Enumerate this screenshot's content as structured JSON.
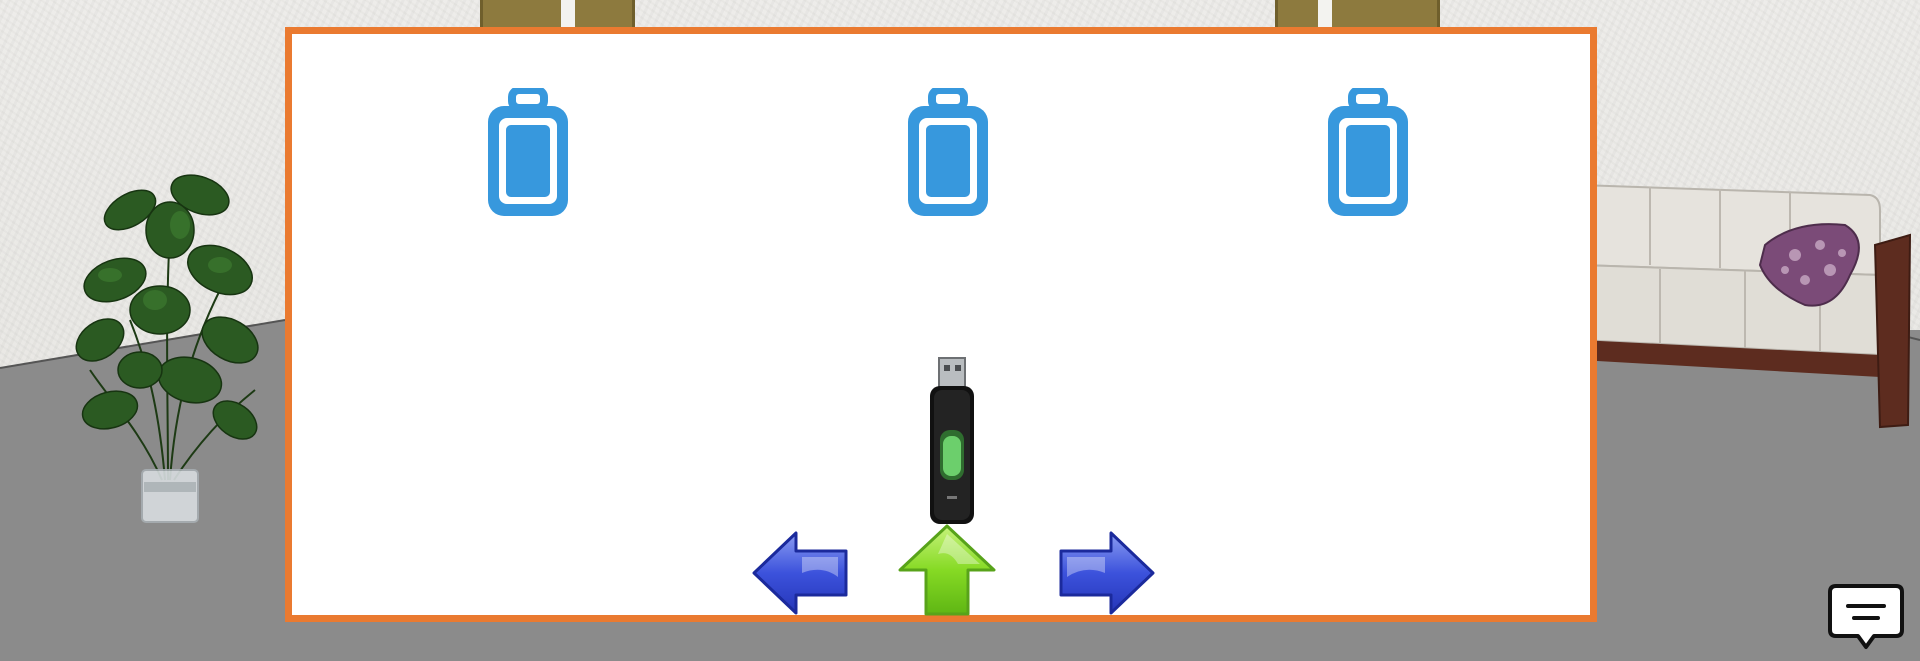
{
  "scene": {
    "name": "room",
    "decor": [
      "plant",
      "sofa",
      "doors"
    ]
  },
  "panel": {
    "border_color": "#ea7a30",
    "slots": [
      {
        "icon": "battery-empty-icon",
        "color": "#3798dd"
      },
      {
        "icon": "battery-empty-icon",
        "color": "#3798dd"
      },
      {
        "icon": "battery-empty-icon",
        "color": "#3798dd"
      }
    ],
    "held_item": {
      "icon": "usb-flash-drive-icon"
    }
  },
  "navigation": {
    "left": {
      "icon": "arrow-left-icon",
      "color": "#3a4fd6"
    },
    "up": {
      "icon": "arrow-up-icon",
      "color": "#7fd81e"
    },
    "right": {
      "icon": "arrow-right-icon",
      "color": "#3a4fd6"
    }
  },
  "chat": {
    "icon": "chat-bubble-icon"
  }
}
